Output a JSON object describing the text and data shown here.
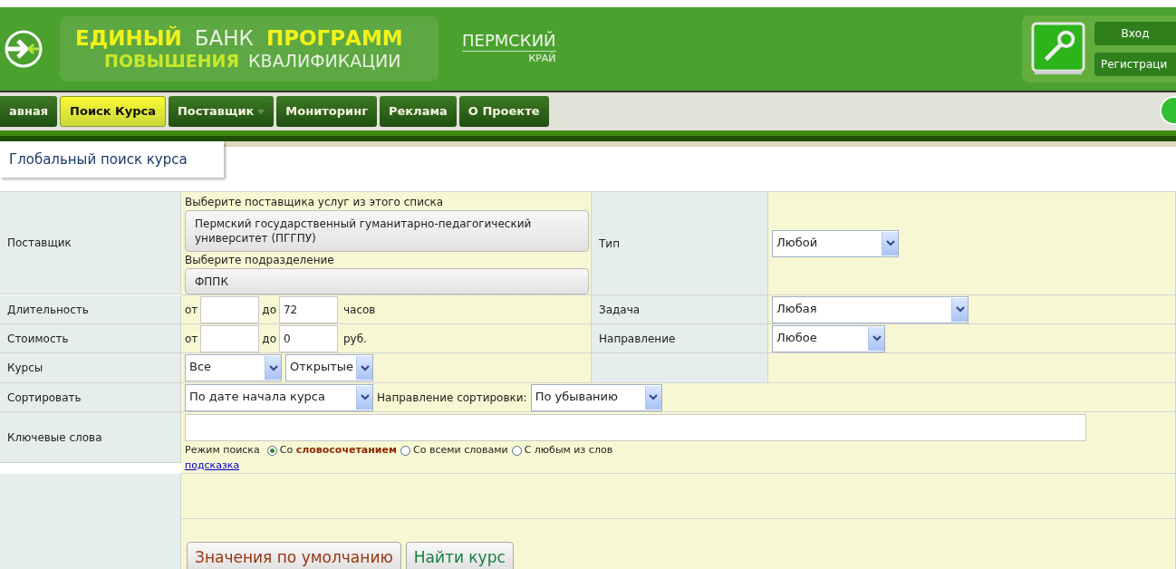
{
  "header": {
    "logo_words": [
      {
        "text": "ЕДИНЫЙ",
        "accent": true
      },
      {
        "text": "БАНК",
        "accent": false
      },
      {
        "text": "ПРОГРАММ",
        "accent": true
      }
    ],
    "logo_words_2": [
      {
        "text": "ПОВЫШЕНИЯ",
        "accent": true
      },
      {
        "text": "КВАЛИФИКАЦИИ",
        "accent": false
      }
    ],
    "region": "ПЕРМСКИЙ",
    "region_sub": "КРАЙ",
    "login": "Вход",
    "register": "Регистраци"
  },
  "nav": [
    {
      "label": "авная",
      "selected": false,
      "dropdown": false
    },
    {
      "label": "Поиск Курса",
      "selected": true,
      "dropdown": false
    },
    {
      "label": "Поставщик",
      "selected": false,
      "dropdown": true
    },
    {
      "label": "Мониторинг",
      "selected": false,
      "dropdown": false
    },
    {
      "label": "Реклама",
      "selected": false,
      "dropdown": false
    },
    {
      "label": "О Проекте",
      "selected": false,
      "dropdown": false
    }
  ],
  "page_tab": "Глобальный поиск курса",
  "form": {
    "provider": {
      "label": "Поставщик",
      "hint": "Выберите поставщика услуг из этого списка",
      "value": "Пермский государственный гуманитарно-педагогический университет (ПГГПУ)",
      "sub_hint": "Выберите подразделение",
      "sub_value": "ФППК"
    },
    "type": {
      "label": "Тип",
      "value": "Любой"
    },
    "duration": {
      "label": "Длительность",
      "from": "от",
      "to": "до",
      "to_value": "72",
      "unit": "часов"
    },
    "task": {
      "label": "Задача",
      "value": "Любая"
    },
    "cost": {
      "label": "Стоимость",
      "from": "от",
      "to": "до",
      "to_value": "0",
      "unit": "руб."
    },
    "direction": {
      "label": "Направление",
      "value": "Любое"
    },
    "courses": {
      "label": "Курсы",
      "value": "Все",
      "status": "Открытые"
    },
    "sort": {
      "label": "Сортировать",
      "value": "По дате начала курса",
      "order_label": "Направление сортировки:",
      "order": "По убыванию"
    },
    "keywords": {
      "label": "Ключевые слова",
      "mode_label": "Режим поиска",
      "modes": [
        {
          "label": "Со **словосочетанием**",
          "selected": true
        },
        {
          "label": "Со всеми словами",
          "selected": false
        },
        {
          "label": "С любым из слов",
          "selected": false
        }
      ],
      "hint_link": "подсказка"
    },
    "buttons": [
      {
        "label": "Значения по умолчанию",
        "kind": "reset"
      },
      {
        "label": "Найти курс",
        "kind": "submit"
      }
    ]
  }
}
